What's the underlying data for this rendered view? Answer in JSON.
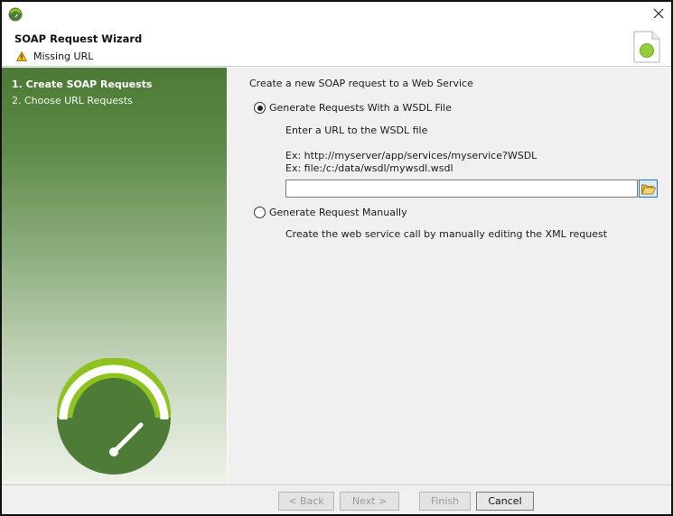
{
  "window": {
    "title_icon": "app-gauge-icon",
    "close_icon": "close-icon"
  },
  "header": {
    "title": "SOAP Request Wizard",
    "status_icon": "warning-icon",
    "status": "Missing URL",
    "side_icon": "document-icon"
  },
  "steps": [
    {
      "label": "1. Create SOAP Requests",
      "active": true
    },
    {
      "label": "2. Choose URL Requests",
      "active": false
    }
  ],
  "content": {
    "intro": "Create a new SOAP request to a Web Service",
    "option_wsdl": {
      "label": "Generate Requests With a WSDL File",
      "selected": true,
      "help": "Enter a URL to the WSDL file",
      "example_1": "Ex: http://myserver/app/services/myservice?WSDL",
      "example_2": "Ex: file:/c:/data/wsdl/mywsdl.wsdl",
      "url_value": "",
      "browse_icon": "folder-open-icon"
    },
    "option_manual": {
      "label": "Generate Request Manually",
      "selected": false,
      "help": "Create the web service call by manually editing the XML request"
    }
  },
  "footer": {
    "back_label": "< Back",
    "next_label": "Next >",
    "finish_label": "Finish",
    "cancel_label": "Cancel"
  },
  "colors": {
    "brand_green": "#4c7a36",
    "logo_lime": "#8dc21f",
    "logo_dark": "#4e7c37"
  }
}
